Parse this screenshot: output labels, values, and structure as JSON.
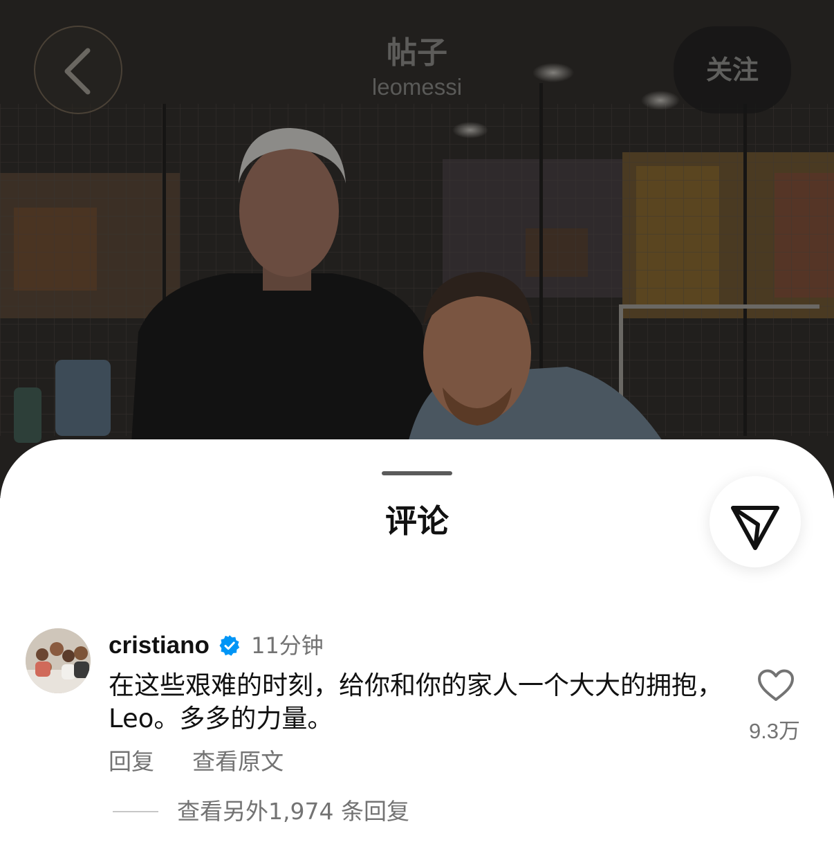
{
  "header": {
    "title": "帖子",
    "subtitle": "leomessi",
    "follow_label": "关注",
    "back_icon": "chevron-left-icon"
  },
  "sheet": {
    "title": "评论",
    "share_icon": "paper-plane-icon"
  },
  "comment": {
    "username": "cristiano",
    "verified": true,
    "time": "11分钟",
    "text": "在这些艰难的时刻，给你和你的家人一个大大的拥抱，Leo。多多的力量。",
    "reply_label": "回复",
    "see_original_label": "查看原文",
    "like_icon": "heart-icon",
    "like_count": "9.3万",
    "view_replies_label": "查看另外1,974 条回复"
  },
  "colors": {
    "verified_blue": "#0095f6",
    "secondary_text": "#737373",
    "primary_text": "#111111"
  }
}
